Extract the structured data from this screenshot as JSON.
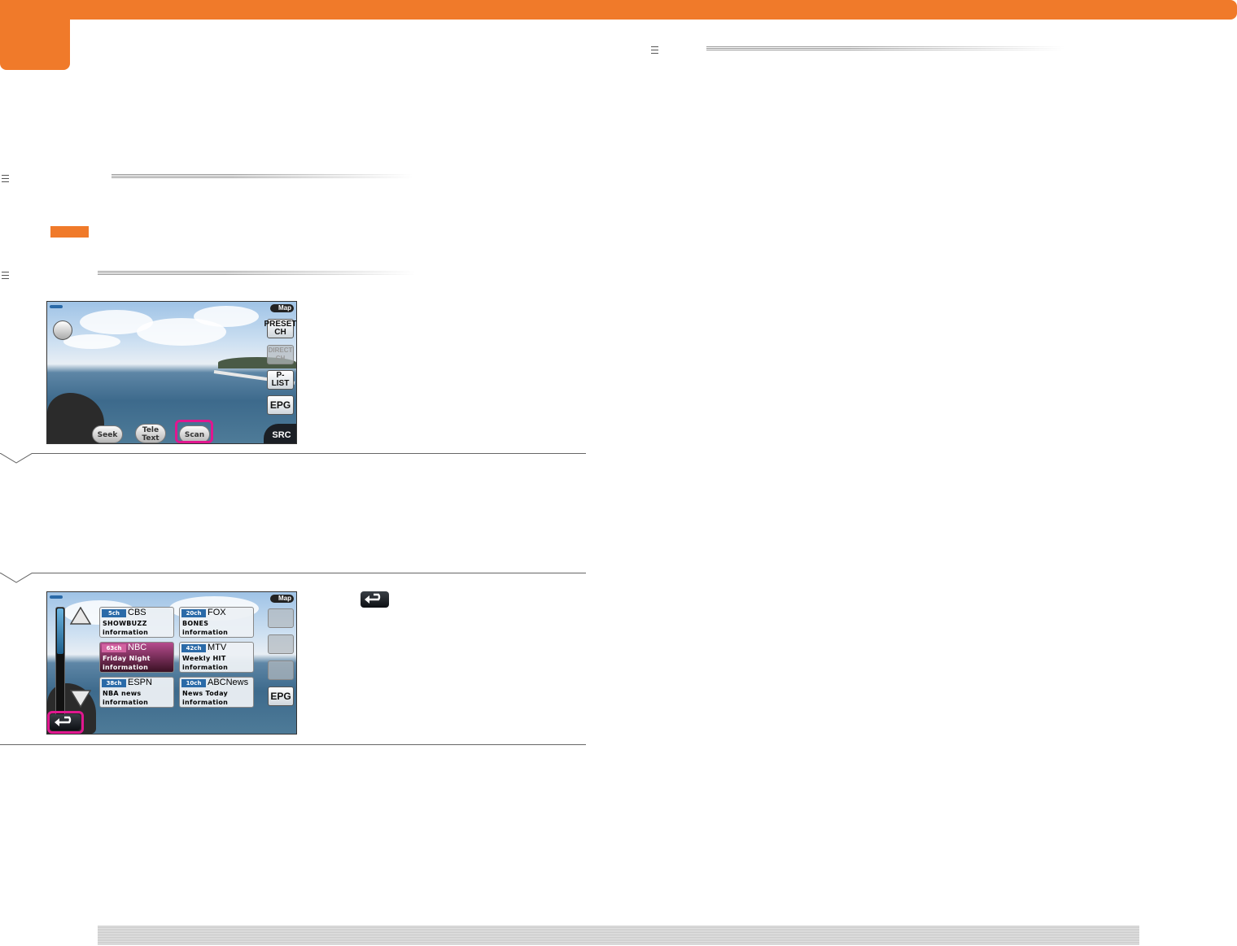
{
  "screen1": {
    "map_label": "Map",
    "preset_label": "PRESET\nCH",
    "direct_label": "DIRECT\nCH",
    "plist_label": "P-LIST",
    "epg_label": "EPG",
    "seek_label": "Seek",
    "teletext_label": "Tele\nText",
    "scan_label": "Scan",
    "src_label": "SRC"
  },
  "screen2": {
    "map_label": "Map",
    "epg_label": "EPG",
    "channels": [
      {
        "num": "5ch",
        "name": "CBS",
        "line1": "SHOWBUZZ",
        "line2": "information"
      },
      {
        "num": "20ch",
        "name": "FOX",
        "line1": "BONES",
        "line2": "information"
      },
      {
        "num": "63ch",
        "name": "NBC",
        "line1": "Friday Night",
        "line2": "information"
      },
      {
        "num": "42ch",
        "name": "MTV",
        "line1": "Weekly HIT",
        "line2": "information"
      },
      {
        "num": "38ch",
        "name": "ESPN",
        "line1": "NBA news",
        "line2": "information"
      },
      {
        "num": "10ch",
        "name": "ABCNews",
        "line1": "News Today",
        "line2": "information"
      }
    ]
  },
  "colors": {
    "accent": "#f07a2a",
    "highlight": "#e0178f"
  },
  "icons": [
    "section-menu-icon",
    "back-arrow-icon",
    "up-arrow-icon",
    "down-arrow-icon"
  ]
}
